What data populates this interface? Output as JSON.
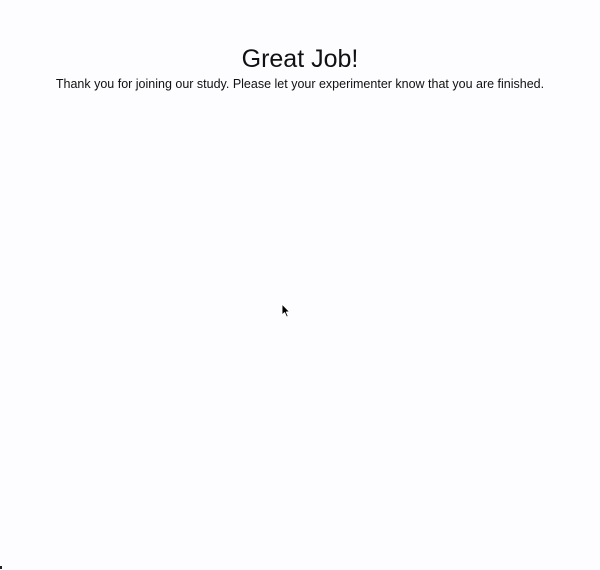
{
  "completion": {
    "title": "Great Job!",
    "message": "Thank you for joining our study. Please let your experimenter know that you are finished."
  },
  "icons": {
    "cursor": "mouse-pointer-icon"
  }
}
